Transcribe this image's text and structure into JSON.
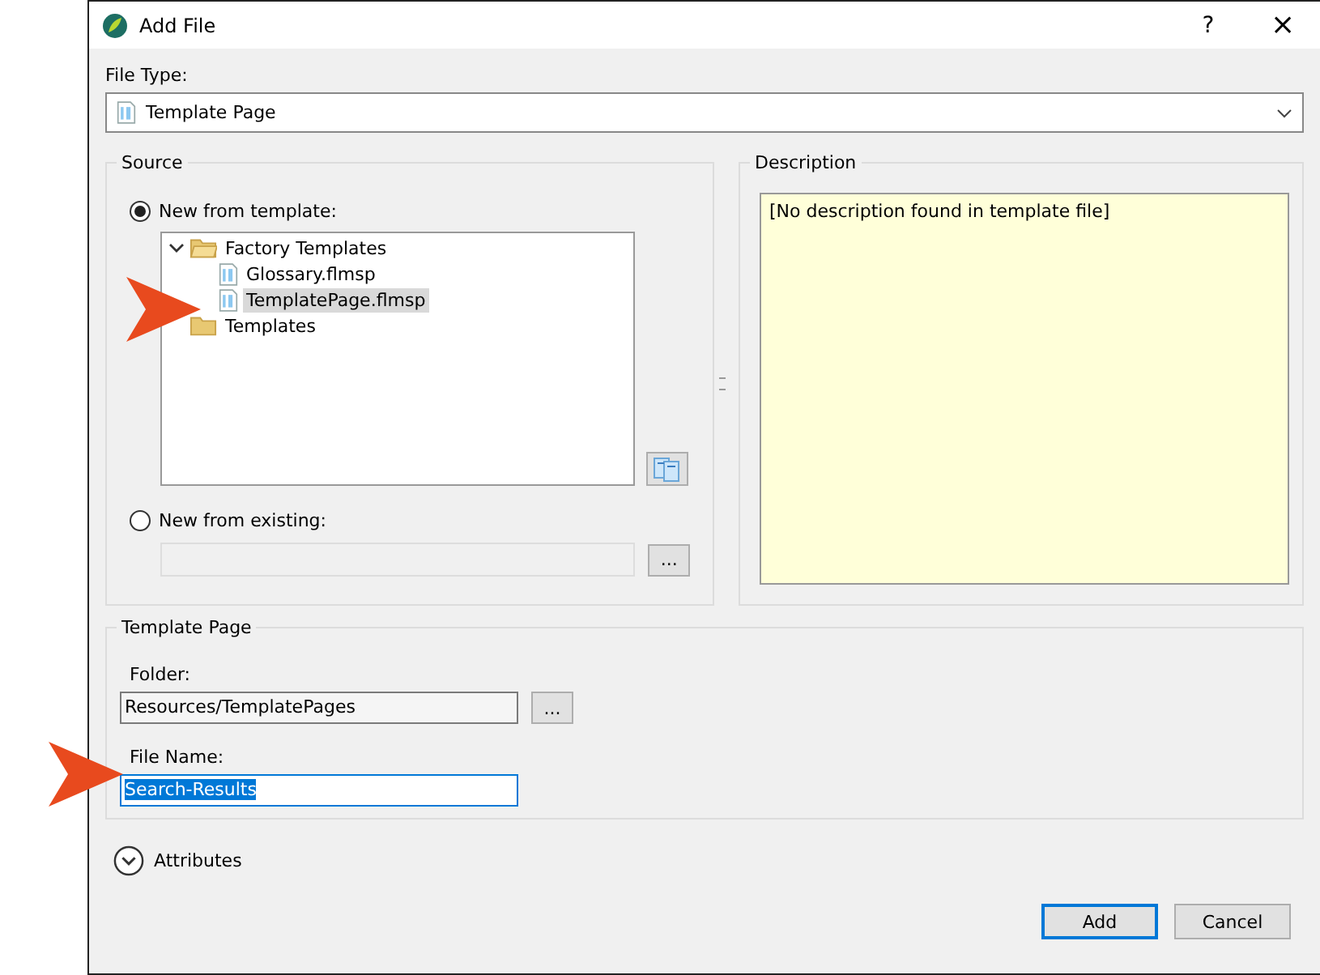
{
  "window": {
    "title": "Add File",
    "help": "?",
    "close": "×"
  },
  "file_type": {
    "label": "File Type:",
    "value": "Template Page"
  },
  "source": {
    "title": "Source",
    "options": [
      {
        "label": "New from template:",
        "selected": true
      },
      {
        "label": "New from existing:",
        "selected": false
      }
    ],
    "tree": [
      {
        "label": "Factory Templates",
        "kind": "folder",
        "expanded": true,
        "selected": false,
        "children": [
          {
            "label": "Glossary.flmsp",
            "kind": "file",
            "selected": false
          },
          {
            "label": "TemplatePage.flmsp",
            "kind": "file",
            "selected": true
          }
        ]
      },
      {
        "label": "Templates",
        "kind": "folder",
        "expanded": false,
        "selected": false
      }
    ],
    "existing_path": {
      "disabled": true
    },
    "browse": "..."
  },
  "description": {
    "title": "Description",
    "text": "[No description found in template file]"
  },
  "template_page": {
    "title": "Template Page",
    "folder_label": "Folder:",
    "folder": "Resources/TemplatePages",
    "browse": "...",
    "file_name_label": "File Name:",
    "file_name": "Search-Results",
    "file_name_selected": true
  },
  "attributes": {
    "label": "Attributes",
    "expanded": false
  },
  "buttons": [
    {
      "label": "Add",
      "default": true
    },
    {
      "label": "Cancel",
      "default": false
    }
  ]
}
